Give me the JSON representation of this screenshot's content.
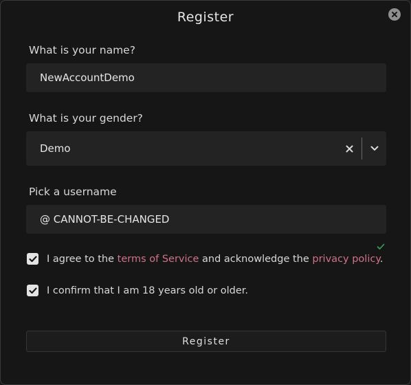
{
  "dialog": {
    "title": "Register",
    "close_icon": "close-icon"
  },
  "name": {
    "label": "What is your name?",
    "value": "NewAccountDemo"
  },
  "gender": {
    "label": "What is your gender?",
    "value": "Demo",
    "clear_icon": "x-icon",
    "dropdown_icon": "chevron-down-icon"
  },
  "username": {
    "label": "Pick a username",
    "value": "@ CANNOT-BE-CHANGED",
    "valid_icon": "checkmark-icon",
    "valid_color": "#3aa35a"
  },
  "terms": {
    "checked": true,
    "text_before": "I agree to the ",
    "terms_link": "terms of Service",
    "text_middle": " and acknowledge the ",
    "privacy_link": "privacy policy",
    "text_after": "."
  },
  "age": {
    "checked": true,
    "text": "I confirm that I am 18 years old or older."
  },
  "submit": {
    "label": "Register"
  },
  "colors": {
    "background": "#161616",
    "field": "#232323",
    "link": "#d0728a",
    "text": "#e6e6e6"
  }
}
